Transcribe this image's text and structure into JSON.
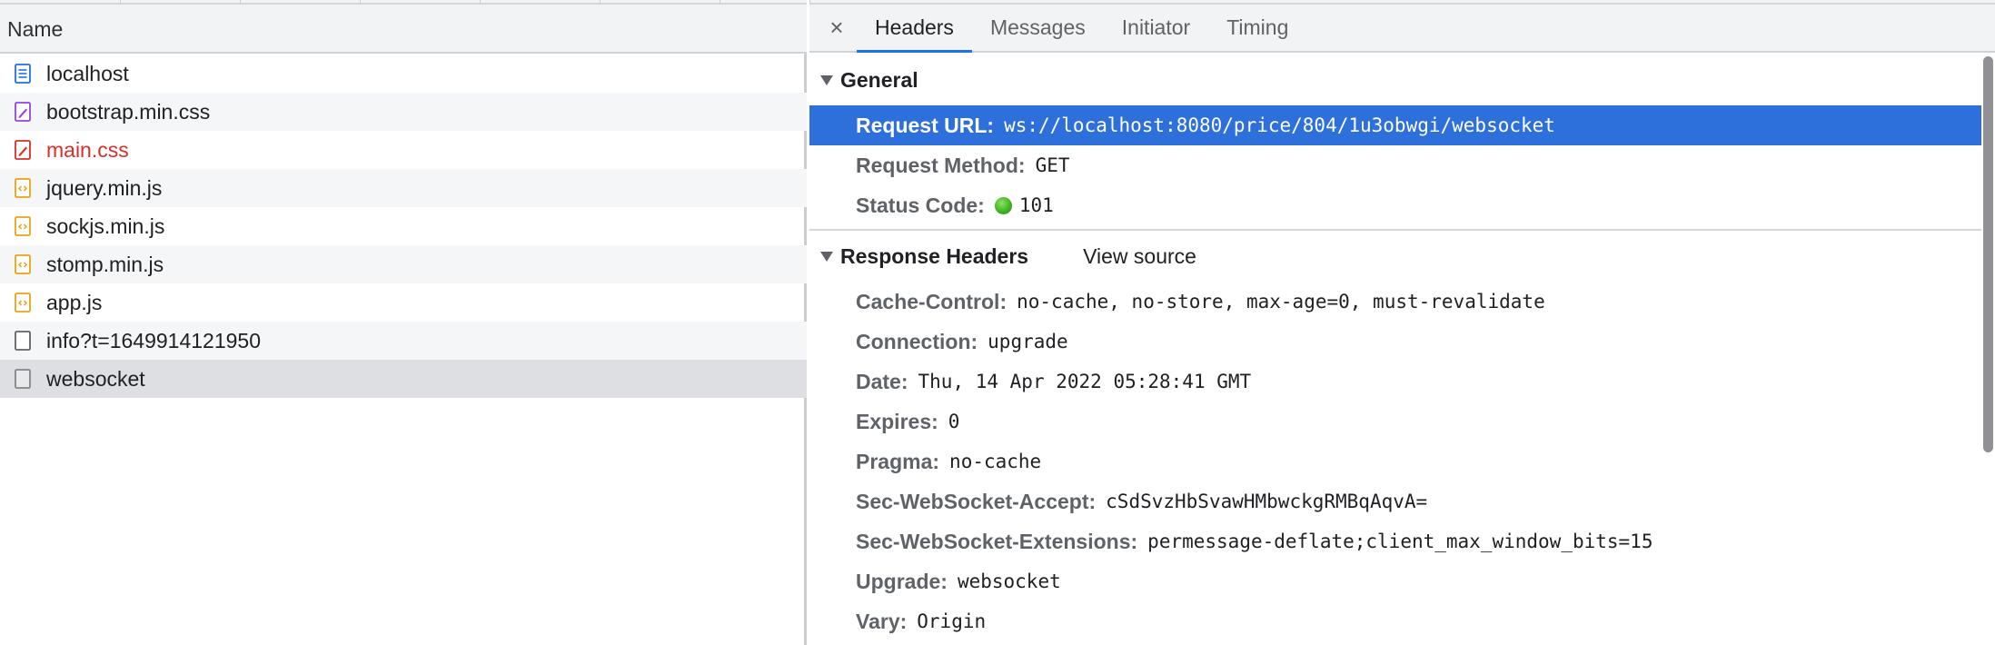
{
  "request_list": {
    "column_header": "Name",
    "requests": [
      {
        "name": "localhost",
        "icon": "document-icon",
        "color": "#1a73e8"
      },
      {
        "name": "bootstrap.min.css",
        "icon": "stylesheet-icon",
        "color": "#9c3fe3"
      },
      {
        "name": "main.css",
        "icon": "stylesheet-icon",
        "color": "#d93025",
        "error": true
      },
      {
        "name": "jquery.min.js",
        "icon": "script-icon",
        "color": "#e8a317"
      },
      {
        "name": "sockjs.min.js",
        "icon": "script-icon",
        "color": "#e8a317"
      },
      {
        "name": "stomp.min.js",
        "icon": "script-icon",
        "color": "#e8a317"
      },
      {
        "name": "app.js",
        "icon": "script-icon",
        "color": "#e8a317"
      },
      {
        "name": "info?t=1649914121950",
        "icon": "blank-file-icon",
        "color": "#5f6368"
      },
      {
        "name": "websocket",
        "icon": "blank-file-icon",
        "color": "#80868b",
        "selected": true
      }
    ]
  },
  "details": {
    "close_symbol": "×",
    "tabs": [
      {
        "label": "Headers",
        "active": true
      },
      {
        "label": "Messages"
      },
      {
        "label": "Initiator"
      },
      {
        "label": "Timing"
      }
    ],
    "general": {
      "title": "General",
      "rows": [
        {
          "name": "Request URL:",
          "value": "ws://localhost:8080/price/804/1u3obwgi/websocket",
          "highlighted": true
        },
        {
          "name": "Request Method:",
          "value": "GET"
        },
        {
          "name": "Status Code:",
          "value": "101",
          "status_dot_color": "#3fb51d"
        }
      ]
    },
    "response_headers": {
      "title": "Response Headers",
      "view_source_label": "View source",
      "rows": [
        {
          "name": "Cache-Control:",
          "value": "no-cache, no-store, max-age=0, must-revalidate"
        },
        {
          "name": "Connection:",
          "value": "upgrade"
        },
        {
          "name": "Date:",
          "value": "Thu, 14 Apr 2022 05:28:41 GMT"
        },
        {
          "name": "Expires:",
          "value": "0"
        },
        {
          "name": "Pragma:",
          "value": "no-cache"
        },
        {
          "name": "Sec-WebSocket-Accept:",
          "value": "cSdSvzHbSvawHMbwckgRMBqAqvA="
        },
        {
          "name": "Sec-WebSocket-Extensions:",
          "value": "permessage-deflate;client_max_window_bits=15"
        },
        {
          "name": "Upgrade:",
          "value": "websocket"
        },
        {
          "name": "Vary:",
          "value": "Origin"
        }
      ]
    }
  },
  "colors": {
    "selection_highlight": "#2d6fdb",
    "active_tab_underline": "#1a73e8"
  }
}
